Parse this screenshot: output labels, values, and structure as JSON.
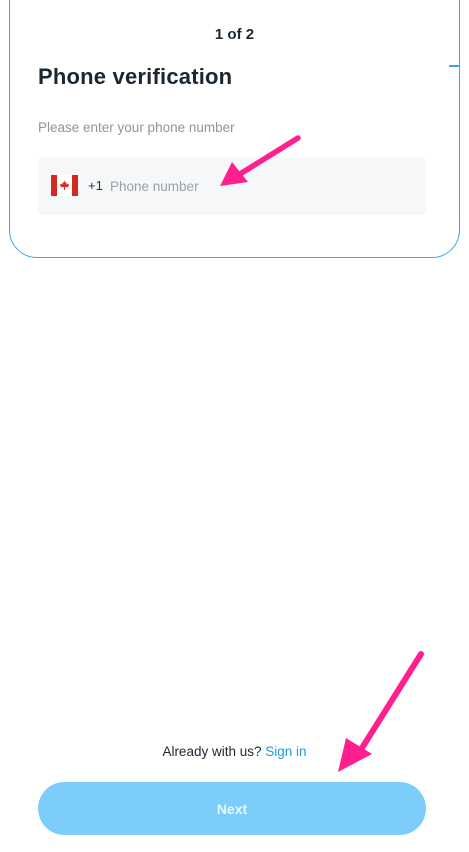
{
  "header": {
    "step_label": "1 of 2",
    "title": "Phone verification"
  },
  "form": {
    "prompt": "Please enter your phone number",
    "phone": {
      "country_flag": "canada-flag-icon",
      "dial_code": "+1",
      "placeholder": "Phone number",
      "value": ""
    }
  },
  "footer": {
    "signin_prompt": "Already with us?",
    "signin_link": "Sign in",
    "next_label": "Next"
  },
  "colors": {
    "accent": "#1a9be6",
    "card_border": "#3aa7e0",
    "button_disabled": "#7dcdfa",
    "annotation_arrow": "#ff1f8f",
    "flag_red": "#d52b1e"
  },
  "annotations": [
    {
      "name": "arrow-to-phone-input",
      "icon": "pink-arrow-icon"
    },
    {
      "name": "arrow-to-sign-in",
      "icon": "pink-arrow-icon"
    }
  ]
}
